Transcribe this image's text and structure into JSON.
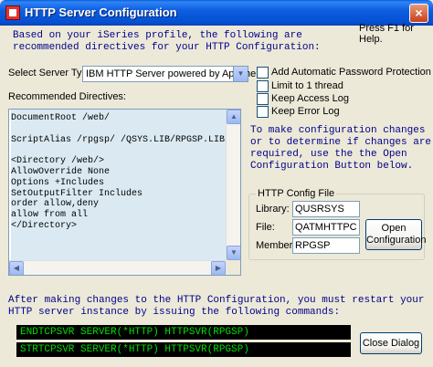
{
  "window": {
    "title": "HTTP Server Configuration",
    "close_glyph": "×"
  },
  "intro_text": "Based on your iSeries profile, the following are\nrecommended directives for your HTTP Configuration:",
  "help_text": "Press F1 for Help.",
  "server_type": {
    "label": "Select Server Type:",
    "selected": "IBM HTTP Server powered by Apache"
  },
  "options": [
    {
      "label": "Add Automatic Password Protection",
      "checked": false
    },
    {
      "label": "Limit to 1 thread",
      "checked": false
    },
    {
      "label": "Keep Access Log",
      "checked": false
    },
    {
      "label": "Keep Error Log",
      "checked": false
    }
  ],
  "directives": {
    "label": "Recommended Directives:",
    "lines": [
      "DocumentRoot /web/",
      "",
      "ScriptAlias /rpgsp/ /QSYS.LIB/RPGSP.LIB/",
      "",
      "<Directory /web/>",
      "AllowOverride None",
      "Options +Includes",
      "SetOutputFilter Includes",
      "order allow,deny",
      "allow from all",
      "</Directory>"
    ]
  },
  "info_text": "To make configuration changes\nor to determine if changes are\nrequired, use the the Open\nConfiguration Button below.",
  "config_file": {
    "title": "HTTP Config File",
    "library_label": "Library:",
    "library_value": "QUSRSYS",
    "file_label": "File:",
    "file_value": "QATMHTTPC",
    "member_label": "Member:",
    "member_value": "RPGSP",
    "open_button": "Open\nConfiguration"
  },
  "footer_text": "After making changes to the HTTP Configuration, you must restart your\nHTTP server instance by issuing the following commands:",
  "commands": [
    "ENDTCPSVR SERVER(*HTTP) HTTPSVR(RPGSP)",
    "STRTCPSVR SERVER(*HTTP) HTTPSVR(RPGSP)"
  ],
  "close_button": "Close Dialog",
  "colors": {
    "title_bar": "#0450d2",
    "info_text": "#00008b",
    "command_text": "#00e000",
    "command_bg": "#000000",
    "editor_bg": "#dbeaf2"
  }
}
